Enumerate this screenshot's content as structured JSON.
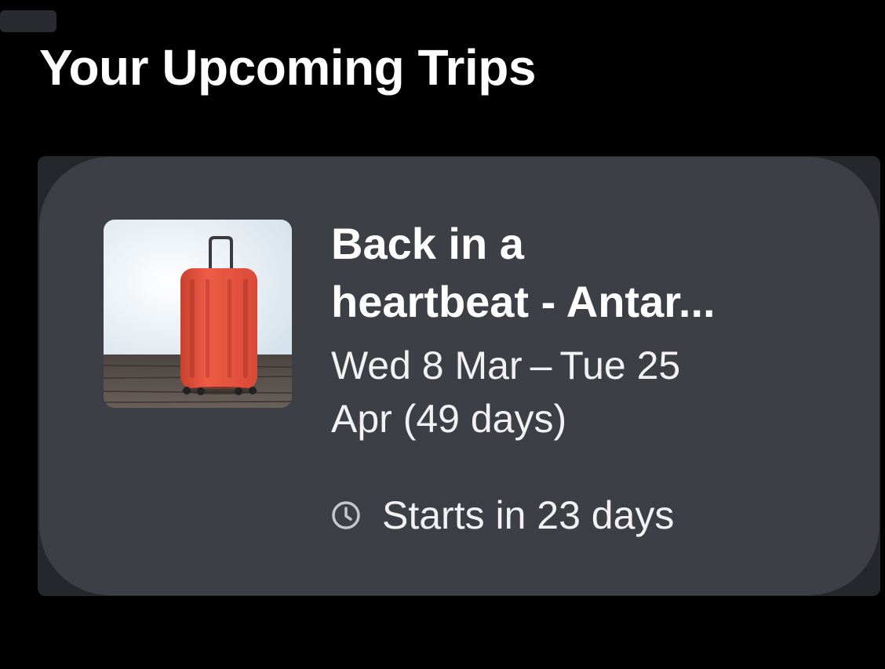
{
  "header": {
    "title": "Your Upcoming Trips"
  },
  "trip": {
    "title_line1": "Back in a",
    "title_line2": "heartbeat - Antar...",
    "dates_line1": "Wed 8 Mar – Tue 25",
    "dates_line2": "Apr (49 days)",
    "countdown": "Starts in 23 days",
    "image_icon": "suitcase-image",
    "countdown_icon": "clock-icon"
  },
  "colors": {
    "background": "#000000",
    "card": "#3d3f46",
    "text": "#ffffff",
    "icon": "#c7c7cc",
    "suitcase": "#e8553f"
  }
}
